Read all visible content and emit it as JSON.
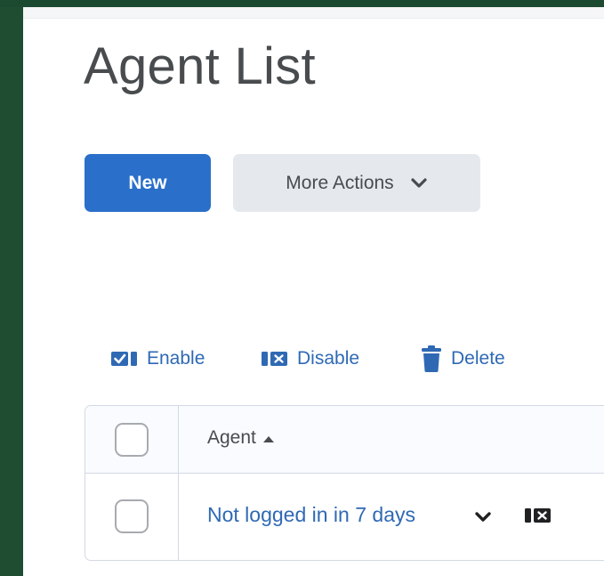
{
  "page": {
    "title": "Agent List"
  },
  "toolbar": {
    "new_label": "New",
    "more_actions_label": "More Actions"
  },
  "bulk_actions": [
    {
      "label": "Enable",
      "icon": "enable-icon"
    },
    {
      "label": "Disable",
      "icon": "disable-icon"
    },
    {
      "label": "Delete",
      "icon": "trash-icon"
    }
  ],
  "table": {
    "columns": [
      {
        "label": "Agent",
        "sort": "ascending"
      }
    ],
    "rows": [
      {
        "agent": "Not logged in in 7 days"
      }
    ]
  },
  "colors": {
    "primary": "#2a6fc9",
    "link": "#2f69b4",
    "text": "#494c4e",
    "secondary_button": "#e5e9ee",
    "sidebar": "#1e4d32"
  }
}
